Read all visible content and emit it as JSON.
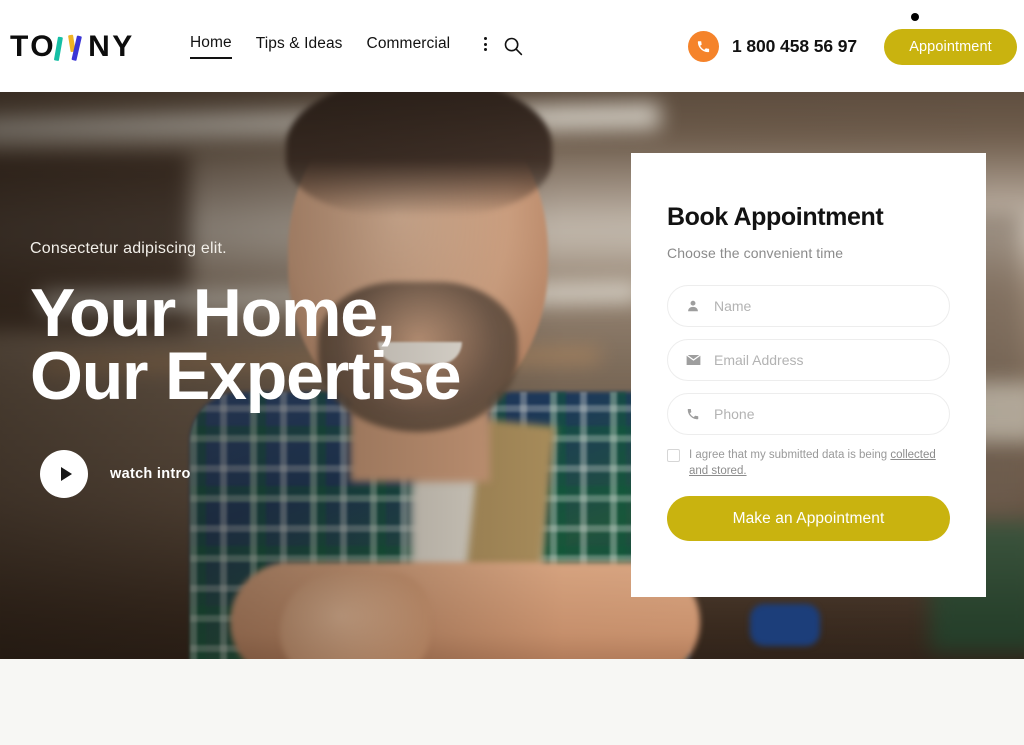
{
  "header": {
    "logo": {
      "before": "TO",
      "w_icon": "logo-w-mark",
      "after": "NY",
      "full_text": "TOWNY"
    },
    "nav": [
      {
        "label": "Home",
        "active": true
      },
      {
        "label": "Tips & Ideas",
        "active": false
      },
      {
        "label": "Commercial",
        "active": false
      }
    ],
    "more_icon": "vertical-dots-icon",
    "search_icon": "search-icon",
    "phone_icon": "phone-icon",
    "phone_number": "1 800 458 56 97",
    "cta_label": "Appointment"
  },
  "hero": {
    "subtitle": "Consectetur adipiscing elit.",
    "title_line1": "Your Home,",
    "title_line2": "Our Expertise",
    "play_icon": "play-icon",
    "watch_label": "watch intro"
  },
  "form": {
    "title": "Book Appointment",
    "subtitle": "Choose the convenient time",
    "fields": [
      {
        "name": "name",
        "icon": "user-icon",
        "placeholder": "Name",
        "value": ""
      },
      {
        "name": "email",
        "icon": "envelope-icon",
        "placeholder": "Email Address",
        "value": ""
      },
      {
        "name": "phone",
        "icon": "phone-icon",
        "placeholder": "Phone",
        "value": ""
      }
    ],
    "consent_text": "I agree that my submitted data is being ",
    "consent_link": "collected and stored.",
    "submit_label": "Make an Appointment"
  },
  "colors": {
    "brand_yellow": "#C9B30F",
    "phone_orange": "#F5832A",
    "logo_teal": "#15BFA5",
    "logo_gold": "#F0B323",
    "logo_blue": "#3B35D6",
    "text_dark": "#121212",
    "page_bg": "#F7F7F4"
  }
}
